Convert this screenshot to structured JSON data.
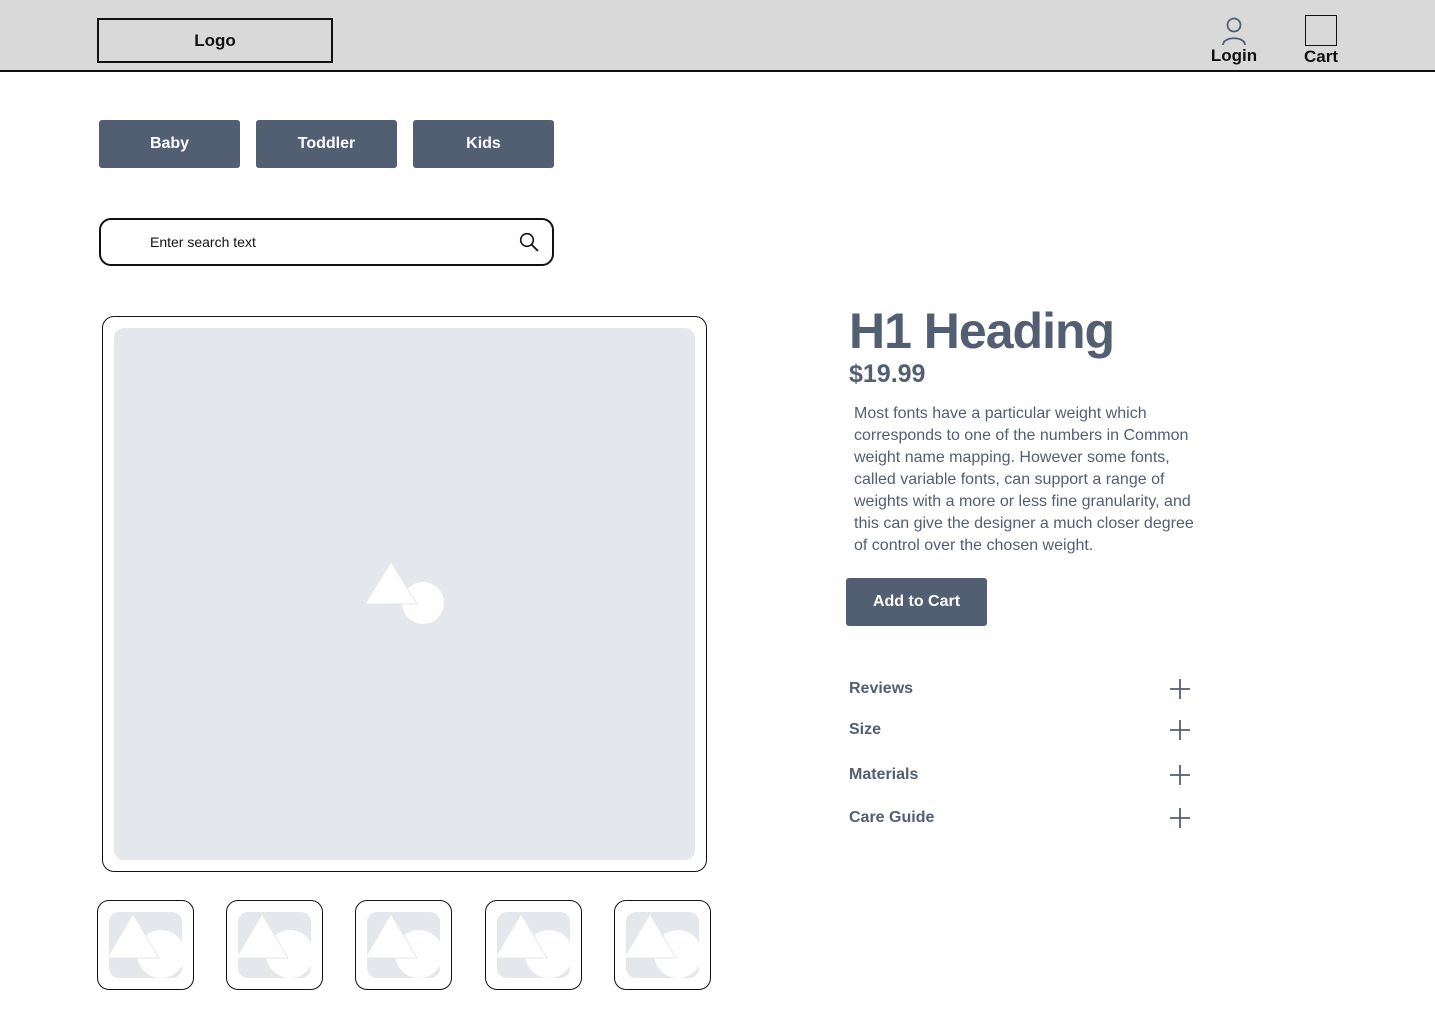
{
  "header": {
    "logo": "Logo",
    "login_label": "Login",
    "cart_label": "Cart"
  },
  "categories": [
    "Baby",
    "Toddler",
    "Kids"
  ],
  "search": {
    "placeholder": "Enter search text"
  },
  "product": {
    "title": "H1 Heading",
    "price": "$19.99",
    "description": "Most fonts have a particular weight which corresponds to one of the numbers in Common weight name mapping. However some fonts, called variable fonts, can support a range of weights with a more or less fine granularity, and this can give the designer a much closer degree of control over the chosen weight.",
    "add_to_cart": "Add to Cart"
  },
  "accordion": [
    "Reviews",
    "Size",
    "Materials",
    "Care Guide"
  ],
  "icons": {
    "login": "user-icon",
    "cart": "cart-icon",
    "search": "search-icon",
    "placeholder": "image-placeholder-icon",
    "expand": "plus-icon"
  },
  "colors": {
    "header_bg": "#d9d9d9",
    "button_bg": "#525e72",
    "image_bg": "#e4e7eb",
    "text_accent": "#525e72"
  }
}
